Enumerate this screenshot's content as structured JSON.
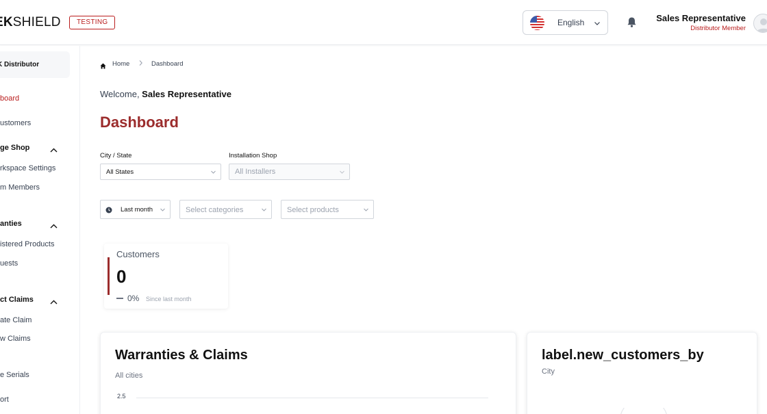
{
  "header": {
    "logo_bold": "EK",
    "logo_rest": "SHIELD",
    "env_badge": "TESTING",
    "language": "English",
    "user_name": "Sales Representative",
    "user_role": "Distributor Member"
  },
  "sidebar": {
    "org_name": "K Distributor",
    "items": [
      {
        "label": "board"
      },
      {
        "label": "ustomers"
      },
      {
        "label": "ge Shop"
      },
      {
        "label": "rkspace Settings"
      },
      {
        "label": "m Members"
      },
      {
        "label": "anties"
      },
      {
        "label": "istered Products"
      },
      {
        "label": "uests"
      },
      {
        "label": "ct Claims"
      },
      {
        "label": "ate Claim"
      },
      {
        "label": "w Claims"
      },
      {
        "label": "e Serials"
      },
      {
        "label": "ort"
      }
    ]
  },
  "breadcrumb": {
    "home": "Home",
    "current": "Dashboard"
  },
  "welcome": {
    "prefix": "Welcome, ",
    "name": "Sales Representative"
  },
  "page_title": "Dashboard",
  "filters": {
    "city_label": "City / State",
    "city_value": "All States",
    "shop_label": "Installation Shop",
    "shop_placeholder": "All Installers",
    "period_value": "Last month",
    "categories_placeholder": "Select categories",
    "products_placeholder": "Select products"
  },
  "stat": {
    "label": "Customers",
    "value": "0",
    "change": "0%",
    "since": "Since last month"
  },
  "cards": {
    "warranties": {
      "title": "Warranties & Claims",
      "subtitle": "All cities",
      "y_tick": "2.5"
    },
    "new_customers": {
      "title": "label.new_customers_by",
      "subtitle": "City"
    }
  },
  "colors": {
    "accent": "#9b2c2c",
    "badge": "#b91c1c"
  }
}
